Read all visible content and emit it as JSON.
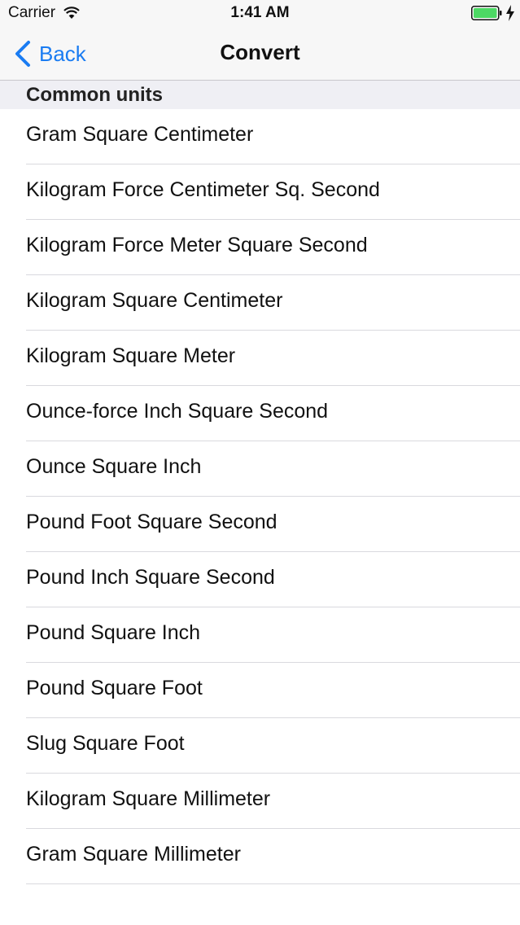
{
  "status_bar": {
    "carrier": "Carrier",
    "time": "1:41 AM",
    "wifi_icon": "wifi-icon",
    "battery_icon": "battery-charging-icon",
    "battery_color": "#4cd964"
  },
  "nav": {
    "back_label": "Back",
    "title": "Convert",
    "accent": "#1a7cf2"
  },
  "section": {
    "title": "Common units"
  },
  "units": [
    {
      "label": "Gram Square Centimeter"
    },
    {
      "label": "Kilogram Force Centimeter Sq. Second"
    },
    {
      "label": "Kilogram Force Meter Square Second"
    },
    {
      "label": "Kilogram Square Centimeter"
    },
    {
      "label": "Kilogram Square Meter"
    },
    {
      "label": "Ounce-force Inch Square Second"
    },
    {
      "label": "Ounce Square Inch"
    },
    {
      "label": "Pound Foot Square Second"
    },
    {
      "label": "Pound Inch Square Second"
    },
    {
      "label": "Pound Square Inch"
    },
    {
      "label": "Pound Square Foot"
    },
    {
      "label": "Slug Square Foot"
    },
    {
      "label": "Kilogram Square Millimeter"
    },
    {
      "label": "Gram Square Millimeter"
    }
  ]
}
